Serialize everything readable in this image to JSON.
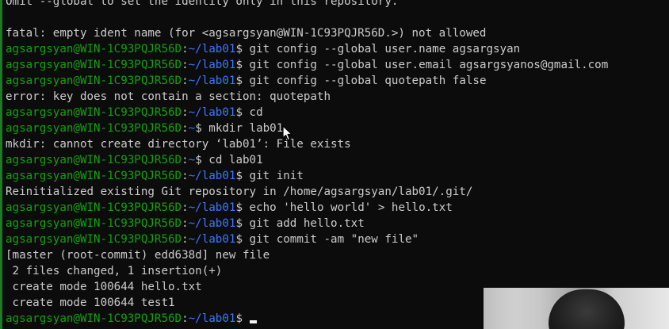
{
  "terminal": {
    "lines": [
      {
        "type": "output",
        "text": "Omit --global to set the identity only in this repository."
      },
      {
        "type": "output",
        "text": ""
      },
      {
        "type": "output",
        "text": "fatal: empty ident name (for <agsargsyan@WIN-1C93PQJR56D.>) not allowed"
      },
      {
        "type": "prompt",
        "user": "agsargsyan@WIN-1C93PQJR56D",
        "sep": ":",
        "path": "~/lab01",
        "sym": "$ ",
        "cmd": "git config --global user.name agsargsyan"
      },
      {
        "type": "prompt",
        "user": "agsargsyan@WIN-1C93PQJR56D",
        "sep": ":",
        "path": "~/lab01",
        "sym": "$ ",
        "cmd": "git config --global user.email agsargsyanos@gmail.com"
      },
      {
        "type": "prompt",
        "user": "agsargsyan@WIN-1C93PQJR56D",
        "sep": ":",
        "path": "~/lab01",
        "sym": "$ ",
        "cmd": "git config --global quotepath false"
      },
      {
        "type": "output",
        "text": "error: key does not contain a section: quotepath"
      },
      {
        "type": "prompt",
        "user": "agsargsyan@WIN-1C93PQJR56D",
        "sep": ":",
        "path": "~/lab01",
        "sym": "$ ",
        "cmd": "cd"
      },
      {
        "type": "prompt",
        "user": "agsargsyan@WIN-1C93PQJR56D",
        "sep": ":",
        "path": "~",
        "sym": "$ ",
        "cmd": "mkdir lab01"
      },
      {
        "type": "output",
        "text": "mkdir: cannot create directory ‘lab01’: File exists"
      },
      {
        "type": "prompt",
        "user": "agsargsyan@WIN-1C93PQJR56D",
        "sep": ":",
        "path": "~",
        "sym": "$ ",
        "cmd": "cd lab01"
      },
      {
        "type": "prompt",
        "user": "agsargsyan@WIN-1C93PQJR56D",
        "sep": ":",
        "path": "~/lab01",
        "sym": "$ ",
        "cmd": "git init"
      },
      {
        "type": "output",
        "text": "Reinitialized existing Git repository in /home/agsargsyan/lab01/.git/"
      },
      {
        "type": "prompt",
        "user": "agsargsyan@WIN-1C93PQJR56D",
        "sep": ":",
        "path": "~/lab01",
        "sym": "$ ",
        "cmd": "echo 'hello world' > hello.txt"
      },
      {
        "type": "prompt",
        "user": "agsargsyan@WIN-1C93PQJR56D",
        "sep": ":",
        "path": "~/lab01",
        "sym": "$ ",
        "cmd": "git add hello.txt"
      },
      {
        "type": "prompt",
        "user": "agsargsyan@WIN-1C93PQJR56D",
        "sep": ":",
        "path": "~/lab01",
        "sym": "$ ",
        "cmd": "git commit -am \"new file\""
      },
      {
        "type": "output",
        "text": "[master (root-commit) edd638d] new file"
      },
      {
        "type": "output",
        "text": " 2 files changed, 1 insertion(+)"
      },
      {
        "type": "output",
        "text": " create mode 100644 hello.txt"
      },
      {
        "type": "output",
        "text": " create mode 100644 test1"
      },
      {
        "type": "prompt",
        "user": "agsargsyan@WIN-1C93PQJR56D",
        "sep": ":",
        "path": "~/lab01",
        "sym": "$ ",
        "cmd": "",
        "cursor": true
      }
    ]
  },
  "colors": {
    "background": "#0c0c0c",
    "text": "#cccccc",
    "prompt_user": "#13a10e",
    "prompt_path": "#3b78ff",
    "window_border": "#1e7a26"
  },
  "icons": {
    "pointer": "mouse-pointer-icon",
    "cursor": "text-cursor-icon"
  }
}
